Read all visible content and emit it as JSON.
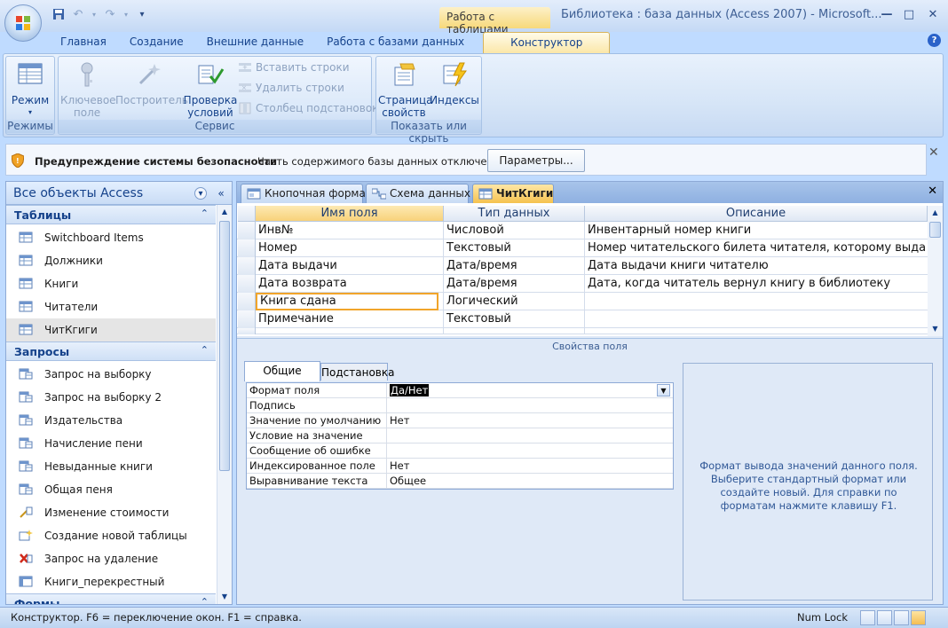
{
  "window": {
    "context_tab": "Работа с таблицами",
    "title": "Библиотека : база данных (Access 2007) - Microsoft..."
  },
  "ribbon": {
    "tabs": [
      "Главная",
      "Создание",
      "Внешние данные",
      "Работа с базами данных",
      "Конструктор"
    ],
    "active_tab": "Конструктор",
    "groups": {
      "modes": {
        "label": "Режимы",
        "view_btn": "Режим"
      },
      "service": {
        "label": "Сервис",
        "key_field_1": "Ключевое",
        "key_field_2": "поле",
        "builder": "Построитель",
        "check_1": "Проверка",
        "check_2": "условий",
        "insert_rows": "Вставить строки",
        "delete_rows": "Удалить строки",
        "lookup_column": "Столбец подстановок"
      },
      "show_hide": {
        "label": "Показать или скрыть",
        "property_1": "Страница",
        "property_2": "свойств",
        "indexes": "Индексы"
      }
    }
  },
  "security": {
    "title": "Предупреждение системы безопасности",
    "text": "Часть содержимого базы данных отключено",
    "button": "Параметры..."
  },
  "nav": {
    "title": "Все объекты Access",
    "sections": [
      {
        "title": "Таблицы",
        "items": [
          "Switchboard Items",
          "Должники",
          "Книги",
          "Читатели",
          "ЧитКгиги"
        ]
      },
      {
        "title": "Запросы",
        "items": [
          "Запрос на выборку",
          "Запрос на выборку 2",
          "Издательства",
          "Начисление пени",
          "Невыданные книги",
          "Общая пеня",
          "Изменение стоимости",
          "Создание новой таблицы",
          "Запрос на удаление",
          "Книги_перекрестный"
        ]
      },
      {
        "title": "Формы",
        "items": []
      }
    ]
  },
  "doc_tabs": [
    "Кнопочная форма",
    "Схема данных",
    "ЧитКгиги"
  ],
  "design_grid": {
    "headers": [
      "Имя поля",
      "Тип данных",
      "Описание"
    ],
    "rows": [
      {
        "name": "Инв№",
        "type": "Числовой",
        "desc": "Инвентарный номер книги"
      },
      {
        "name": "Номер",
        "type": "Текстовый",
        "desc": "Номер читательского билета читателя, которому выдан"
      },
      {
        "name": "Дата выдачи",
        "type": "Дата/время",
        "desc": "Дата выдачи книги читателю"
      },
      {
        "name": "Дата возврата",
        "type": "Дата/время",
        "desc": "Дата, когда читатель вернул книгу в библиотеку"
      },
      {
        "name": "Книга сдана",
        "type": "Логический",
        "desc": ""
      },
      {
        "name": "Примечание",
        "type": "Текстовый",
        "desc": ""
      }
    ]
  },
  "field_properties": {
    "label": "Свойства поля",
    "tabs": [
      "Общие",
      "Подстановка"
    ],
    "rows": [
      {
        "key": "Формат поля",
        "value": "Да/Нет"
      },
      {
        "key": "Подпись",
        "value": ""
      },
      {
        "key": "Значение по умолчанию",
        "value": "Нет"
      },
      {
        "key": "Условие на значение",
        "value": ""
      },
      {
        "key": "Сообщение об ошибке",
        "value": ""
      },
      {
        "key": "Индексированное поле",
        "value": "Нет"
      },
      {
        "key": "Выравнивание текста",
        "value": "Общее"
      }
    ],
    "help": "Формат вывода значений данного поля. Выберите стандартный формат или создайте новый. Для справки по форматам нажмите клавишу F1."
  },
  "status": {
    "text": "Конструктор.  F6 = переключение окон.  F1 = справка.",
    "numlock": "Num Lock"
  }
}
